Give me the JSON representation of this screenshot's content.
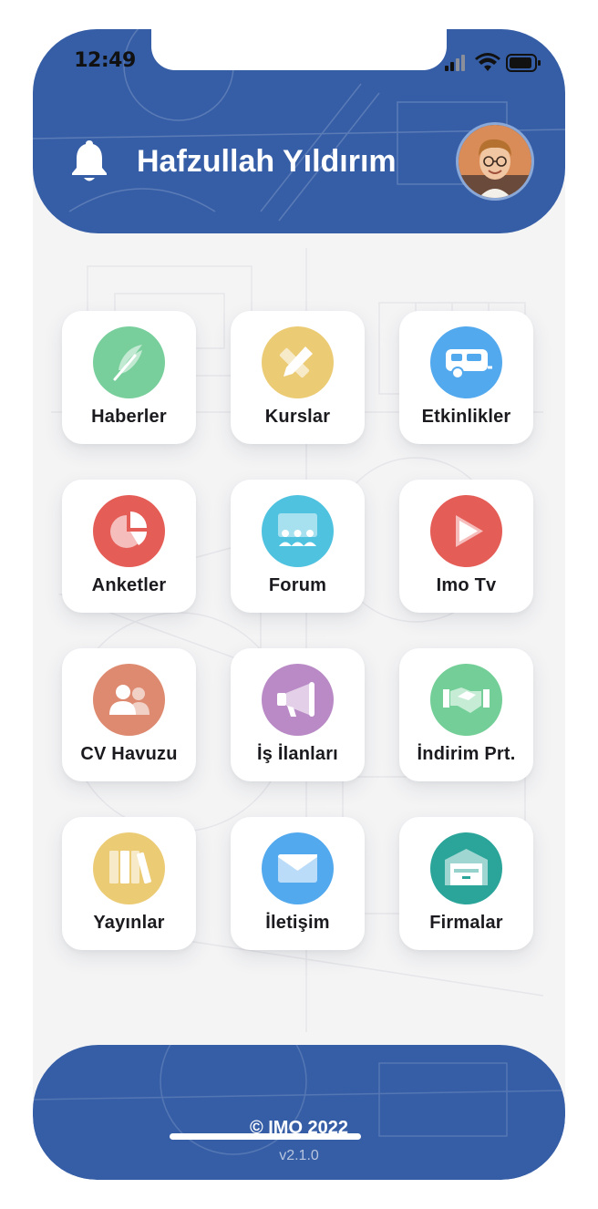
{
  "status_bar": {
    "time": "12:49"
  },
  "header": {
    "user_name": "Hafzullah Yıldırım",
    "bg_color": "#365ea6"
  },
  "menu": {
    "items": [
      {
        "label": "Haberler",
        "icon": "feather-icon",
        "color": "#78cf9c"
      },
      {
        "label": "Kurslar",
        "icon": "pencil-ruler-icon",
        "color": "#eccb75"
      },
      {
        "label": "Etkinlikler",
        "icon": "caravan-icon",
        "color": "#53a9ee"
      },
      {
        "label": "Anketler",
        "icon": "pie-chart-icon",
        "color": "#e55d57"
      },
      {
        "label": "Forum",
        "icon": "presentation-audience-icon",
        "color": "#4fc2e0"
      },
      {
        "label": "Imo Tv",
        "icon": "play-icon",
        "color": "#e55d57"
      },
      {
        "label": "CV Havuzu",
        "icon": "users-icon",
        "color": "#dd8a70"
      },
      {
        "label": "İş İlanları",
        "icon": "megaphone-icon",
        "color": "#b98ac6"
      },
      {
        "label": "İndirim Prt.",
        "icon": "handshake-icon",
        "color": "#73cf97"
      },
      {
        "label": "Yayınlar",
        "icon": "books-icon",
        "color": "#eccb75"
      },
      {
        "label": "İletişim",
        "icon": "envelope-icon",
        "color": "#53a9ee"
      },
      {
        "label": "Firmalar",
        "icon": "warehouse-icon",
        "color": "#2ba59a"
      }
    ]
  },
  "footer": {
    "copyright": "© IMO 2022",
    "version": "v2.1.0"
  }
}
